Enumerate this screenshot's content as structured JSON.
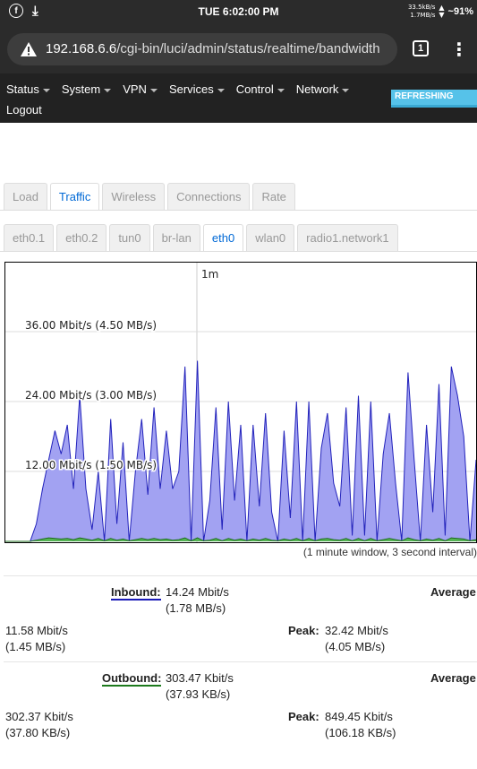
{
  "statusbar": {
    "time": "TUE 6:02:00 PM",
    "net_up": "33.5kB/s",
    "net_down": "1.7MB/s",
    "battery": "~91%",
    "icons": [
      "facebook-icon",
      "download-icon"
    ]
  },
  "browser": {
    "url_host": "192.168.6.6",
    "url_path": "/cgi-bin/luci/admin/status/realtime/bandwidth",
    "tab_count": "1"
  },
  "menu": {
    "items": [
      "Status",
      "System",
      "VPN",
      "Services",
      "Control",
      "Network"
    ],
    "logout": "Logout",
    "refreshing": "REFRESHING"
  },
  "main_tabs": {
    "items": [
      "Load",
      "Traffic",
      "Wireless",
      "Connections",
      "Rate"
    ],
    "active": "Traffic"
  },
  "iface_tabs": {
    "items": [
      "eth0.1",
      "eth0.2",
      "tun0",
      "br-lan",
      "eth0",
      "wlan0",
      "radio1.network1"
    ],
    "active": "eth0"
  },
  "graph": {
    "time_marker": "1m",
    "window_note": "(1 minute window, 3 second interval)",
    "colors": {
      "inbound_fill": "#a2a2f2",
      "inbound_line": "#2222bb",
      "outbound_fill": "#55b455",
      "outbound_line": "#1c6b1c"
    }
  },
  "chart_data": {
    "type": "area",
    "ylim": [
      0,
      48
    ],
    "yunit": "Mbit/s",
    "tick_labels": [
      "12.00 Mbit/s (1.50 MB/s)",
      "24.00 Mbit/s (3.00 MB/s)",
      "36.00 Mbit/s (4.50 MB/s)"
    ],
    "tick_values": [
      12,
      24,
      36
    ],
    "series": [
      {
        "name": "Inbound",
        "values": [
          0,
          0,
          0,
          0,
          0,
          3,
          9,
          14,
          19,
          15,
          20,
          9,
          25,
          9,
          2,
          12,
          0,
          21,
          3,
          17,
          0,
          12,
          21,
          8,
          23,
          9,
          19,
          9,
          12,
          30,
          0,
          31,
          0,
          7,
          23,
          2,
          24,
          7,
          20,
          0,
          20,
          6,
          22,
          5,
          0,
          19,
          4,
          24,
          0,
          24,
          0,
          16,
          22,
          10,
          6,
          23,
          1,
          25,
          1,
          24,
          0,
          15,
          22,
          10,
          0,
          29,
          14,
          0,
          20,
          5,
          27,
          1,
          30,
          25,
          18,
          0,
          14
        ]
      },
      {
        "name": "Outbound",
        "values": [
          0,
          0,
          0,
          0,
          0,
          0.2,
          0.4,
          0.6,
          0.5,
          0.4,
          0.5,
          0.3,
          0.6,
          0.4,
          0.2,
          0.5,
          0.1,
          0.5,
          0.2,
          0.4,
          0.1,
          0.3,
          0.5,
          0.3,
          0.5,
          0.3,
          0.4,
          0.2,
          0.3,
          0.6,
          0.1,
          0.6,
          0.1,
          0.2,
          0.5,
          0.1,
          0.5,
          0.2,
          0.4,
          0.1,
          0.4,
          0.2,
          0.5,
          0.2,
          0.1,
          0.4,
          0.2,
          0.5,
          0.1,
          0.5,
          0.1,
          0.4,
          0.5,
          0.3,
          0.2,
          0.5,
          0.1,
          0.5,
          0.1,
          0.5,
          0.1,
          0.3,
          0.5,
          0.3,
          0.1,
          0.6,
          0.3,
          0.1,
          0.4,
          0.2,
          0.5,
          0.1,
          0.6,
          0.5,
          0.4,
          0.1,
          0.3
        ]
      }
    ]
  },
  "inbound": {
    "label": "Inbound:",
    "current": "14.24 Mbit/s",
    "current_bytes": "(1.78 MB/s)",
    "average_label": "Average",
    "average": "11.58 Mbit/s",
    "average_bytes": "(1.45 MB/s)",
    "peak_label": "Peak:",
    "peak": "32.42 Mbit/s",
    "peak_bytes": "(4.05 MB/s)"
  },
  "outbound": {
    "label": "Outbound:",
    "current": "303.47 Kbit/s",
    "current_bytes": "(37.93 KB/s)",
    "average_label": "Average",
    "average": "302.37 Kbit/s",
    "average_bytes": "(37.80 KB/s)",
    "peak_label": "Peak:",
    "peak": "849.45 Kbit/s",
    "peak_bytes": "(106.18 KB/s)"
  }
}
